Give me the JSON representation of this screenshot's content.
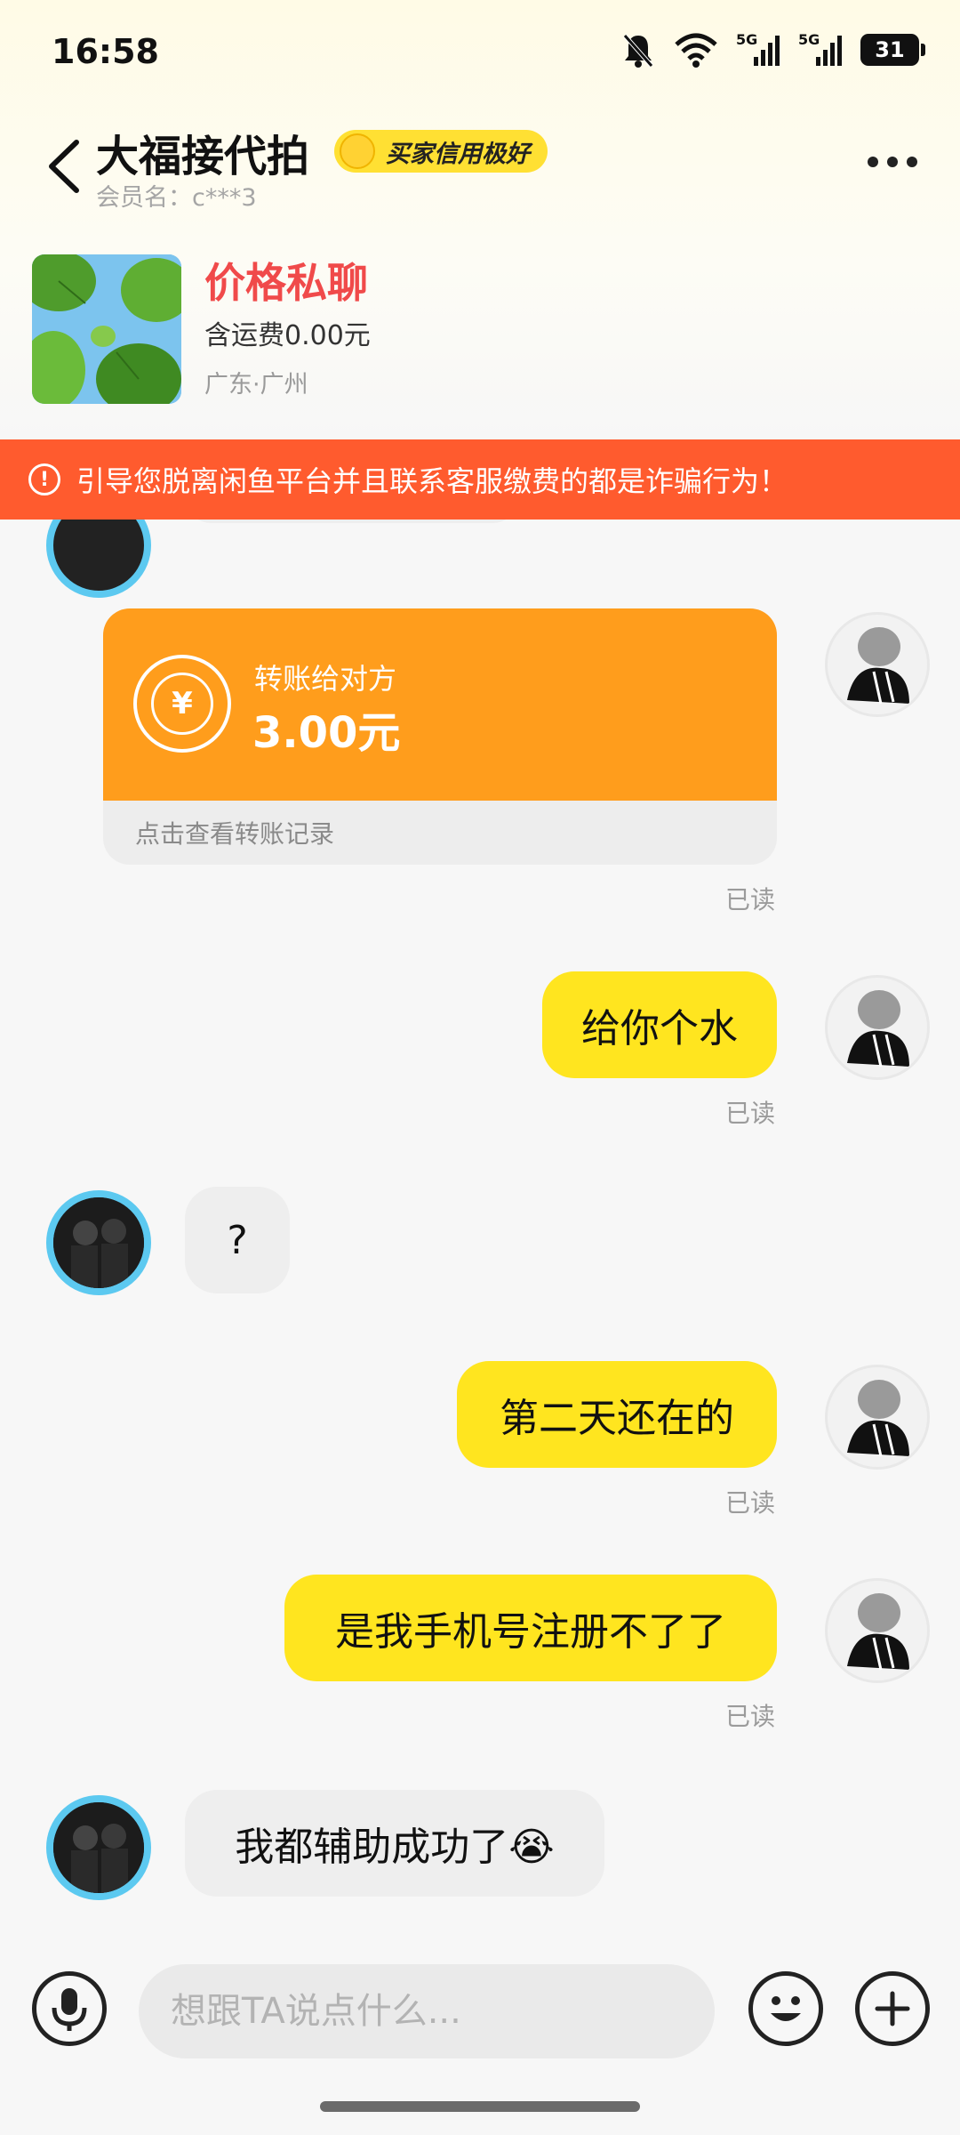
{
  "status_bar": {
    "time": "16:58",
    "network_1": "5G",
    "network_2": "5G",
    "battery": "31",
    "icons": [
      "mute-bell-icon",
      "wifi-icon",
      "signal-icon",
      "signal-icon",
      "battery-icon"
    ]
  },
  "header": {
    "seller_name": "大福接代拍",
    "credit_badge": "买家信用极好",
    "member_label": "会员名：c***3"
  },
  "product": {
    "price": "价格私聊",
    "shipping": "含运费0.00元",
    "location": "广东·广州"
  },
  "warning": {
    "text": "引导您脱离闲鱼平台并且联系客服缴费的都是诈骗行为！"
  },
  "transfer": {
    "title": "转账给对方",
    "amount": "3.00元",
    "link": "点击查看转账记录",
    "coin_symbol": "¥"
  },
  "messages": [
    {
      "sender": "me",
      "text": "给你个水",
      "status": "已读"
    },
    {
      "sender": "other",
      "text": "?"
    },
    {
      "sender": "me",
      "text": "第二天还在的",
      "status": "已读"
    },
    {
      "sender": "me",
      "text": "是我手机号注册不了了",
      "status": "已读"
    },
    {
      "sender": "other",
      "text": "我都辅助成功了😭"
    }
  ],
  "transfer_status": "已读",
  "input": {
    "placeholder": "想跟TA说点什么..."
  },
  "colors": {
    "accent_yellow": "#ffe51f",
    "warning_red": "#ff5b2e",
    "transfer_orange": "#ff9d1c",
    "price_red": "#f04a4a"
  }
}
